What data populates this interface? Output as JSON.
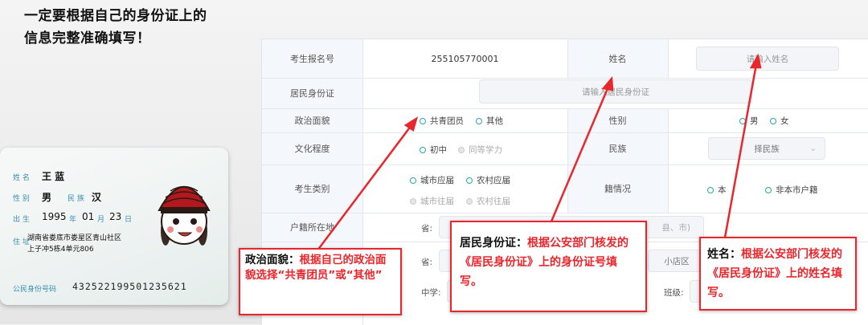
{
  "heading": {
    "line1": "一定要根据自己的身份证上的",
    "line2": "信息完整准确填写！"
  },
  "id_card": {
    "name_label": "姓 名",
    "name_value": "王 蓝",
    "gender_label": "性 别",
    "gender_value": "男",
    "ethnicity_label": "民 族",
    "ethnicity_value": "汉",
    "birth_label": "出 生",
    "birth_year": "1995",
    "birth_year_unit": "年",
    "birth_month": "01",
    "birth_month_unit": "月",
    "birth_day": "23",
    "birth_day_unit": "日",
    "address_label": "住 址",
    "address_line1": "湖南省娄底市娄星区青山社区",
    "address_line2": "上子冲5栋4单元806",
    "id_label": "公民身份号码",
    "id_number": "432522199501235621"
  },
  "form": {
    "exam_no_label": "考生报名号",
    "exam_no_value": "255105770001",
    "name_label": "姓名",
    "name_placeholder": "请输入姓名",
    "id_label": "居民身份证",
    "id_placeholder": "请输入居民身份证",
    "politics_label": "政治面貌",
    "politics_options": [
      "共青团员",
      "其他"
    ],
    "gender_label": "性别",
    "gender_options": [
      "男",
      "女"
    ],
    "culture_label": "文化程度",
    "culture_options": [
      "初中",
      "同等学力"
    ],
    "ethnicity_label": "民族",
    "ethnicity_value": "择民族",
    "category_label": "考生类别",
    "category_options": [
      "城市应届",
      "农村应届",
      "城市往届",
      "农村往届"
    ],
    "household_label": "籍情况",
    "household_options": [
      "本",
      "非本市户籍"
    ],
    "hukou_label": "户籍所在地",
    "province_label": "省:",
    "county_value": "县、市)",
    "province_label_2": "省:",
    "shop_value": "小店区",
    "middle_school_label": "中学:",
    "class_label": "班级:"
  },
  "callouts": {
    "politics": {
      "title": "政治面貌：",
      "body": "根据自己的政治面貌选择“共青团员”或“其他”"
    },
    "id": {
      "title": "居民身份证：",
      "body": "根据公安部门核发的《居民身份证》上的身份证号填写。"
    },
    "name": {
      "title": "姓名：",
      "body": "根据公安部门核发的《居民身份证》上的姓名填写。"
    }
  },
  "colors": {
    "accent_red": "#e8262c",
    "radio_teal": "#2ca6a6",
    "label_bg": "#f4f7fb",
    "card_blue": "#3a8fb0"
  }
}
